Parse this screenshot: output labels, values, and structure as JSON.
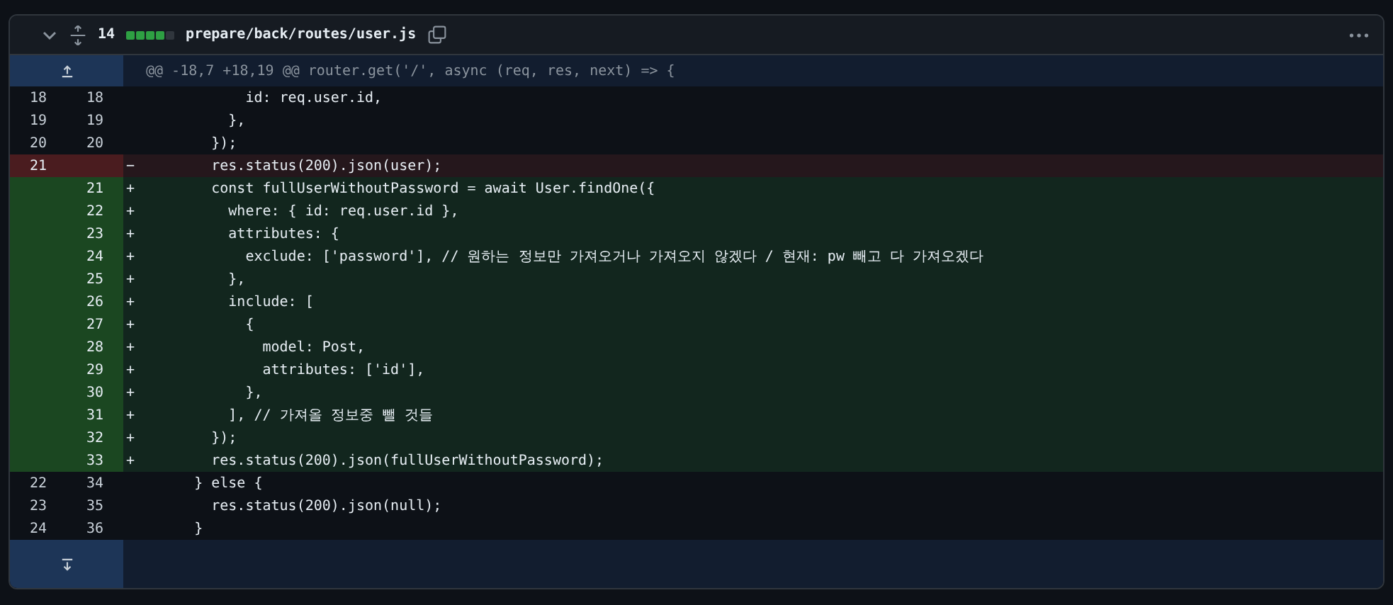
{
  "file_header": {
    "expanded": true,
    "changes": "14",
    "diffstat": [
      {
        "kind": "added"
      },
      {
        "kind": "added"
      },
      {
        "kind": "added"
      },
      {
        "kind": "added"
      },
      {
        "kind": "neutral"
      }
    ],
    "path": "prepare/back/routes/user.js"
  },
  "hunk": {
    "header": "@@ -18,7 +18,19 @@ router.get('/', async (req, res, next) => {"
  },
  "lines": [
    {
      "kind": "context",
      "old": "18",
      "new": "18",
      "code": "          id: req.user.id,"
    },
    {
      "kind": "context",
      "old": "19",
      "new": "19",
      "code": "        },"
    },
    {
      "kind": "context",
      "old": "20",
      "new": "20",
      "code": "      });"
    },
    {
      "kind": "deletion",
      "old": "21",
      "sign": "−",
      "code": "      res.status(200).json(user);"
    },
    {
      "kind": "addition",
      "new": "21",
      "sign": "+",
      "code": "      const fullUserWithoutPassword = await User.findOne({"
    },
    {
      "kind": "addition",
      "new": "22",
      "sign": "+",
      "code": "        where: { id: req.user.id },"
    },
    {
      "kind": "addition",
      "new": "23",
      "sign": "+",
      "code": "        attributes: {"
    },
    {
      "kind": "addition",
      "new": "24",
      "sign": "+",
      "code": "          exclude: ['password'], // 원하는 정보만 가져오거나 가져오지 않겠다 / 현재: pw 빼고 다 가져오겠다"
    },
    {
      "kind": "addition",
      "new": "25",
      "sign": "+",
      "code": "        },"
    },
    {
      "kind": "addition",
      "new": "26",
      "sign": "+",
      "code": "        include: ["
    },
    {
      "kind": "addition",
      "new": "27",
      "sign": "+",
      "code": "          {"
    },
    {
      "kind": "addition",
      "new": "28",
      "sign": "+",
      "code": "            model: Post,"
    },
    {
      "kind": "addition",
      "new": "29",
      "sign": "+",
      "code": "            attributes: ['id'],"
    },
    {
      "kind": "addition",
      "new": "30",
      "sign": "+",
      "code": "          },"
    },
    {
      "kind": "addition",
      "new": "31",
      "sign": "+",
      "code": "        ], // 가져올 정보중 뺄 것들"
    },
    {
      "kind": "addition",
      "new": "32",
      "sign": "+",
      "code": "      });"
    },
    {
      "kind": "addition",
      "new": "33",
      "sign": "+",
      "code": "      res.status(200).json(fullUserWithoutPassword);"
    },
    {
      "kind": "context",
      "old": "22",
      "new": "34",
      "code": "    } else {"
    },
    {
      "kind": "context",
      "old": "23",
      "new": "35",
      "code": "      res.status(200).json(null);"
    },
    {
      "kind": "context",
      "old": "24",
      "new": "36",
      "code": "    }"
    }
  ]
}
